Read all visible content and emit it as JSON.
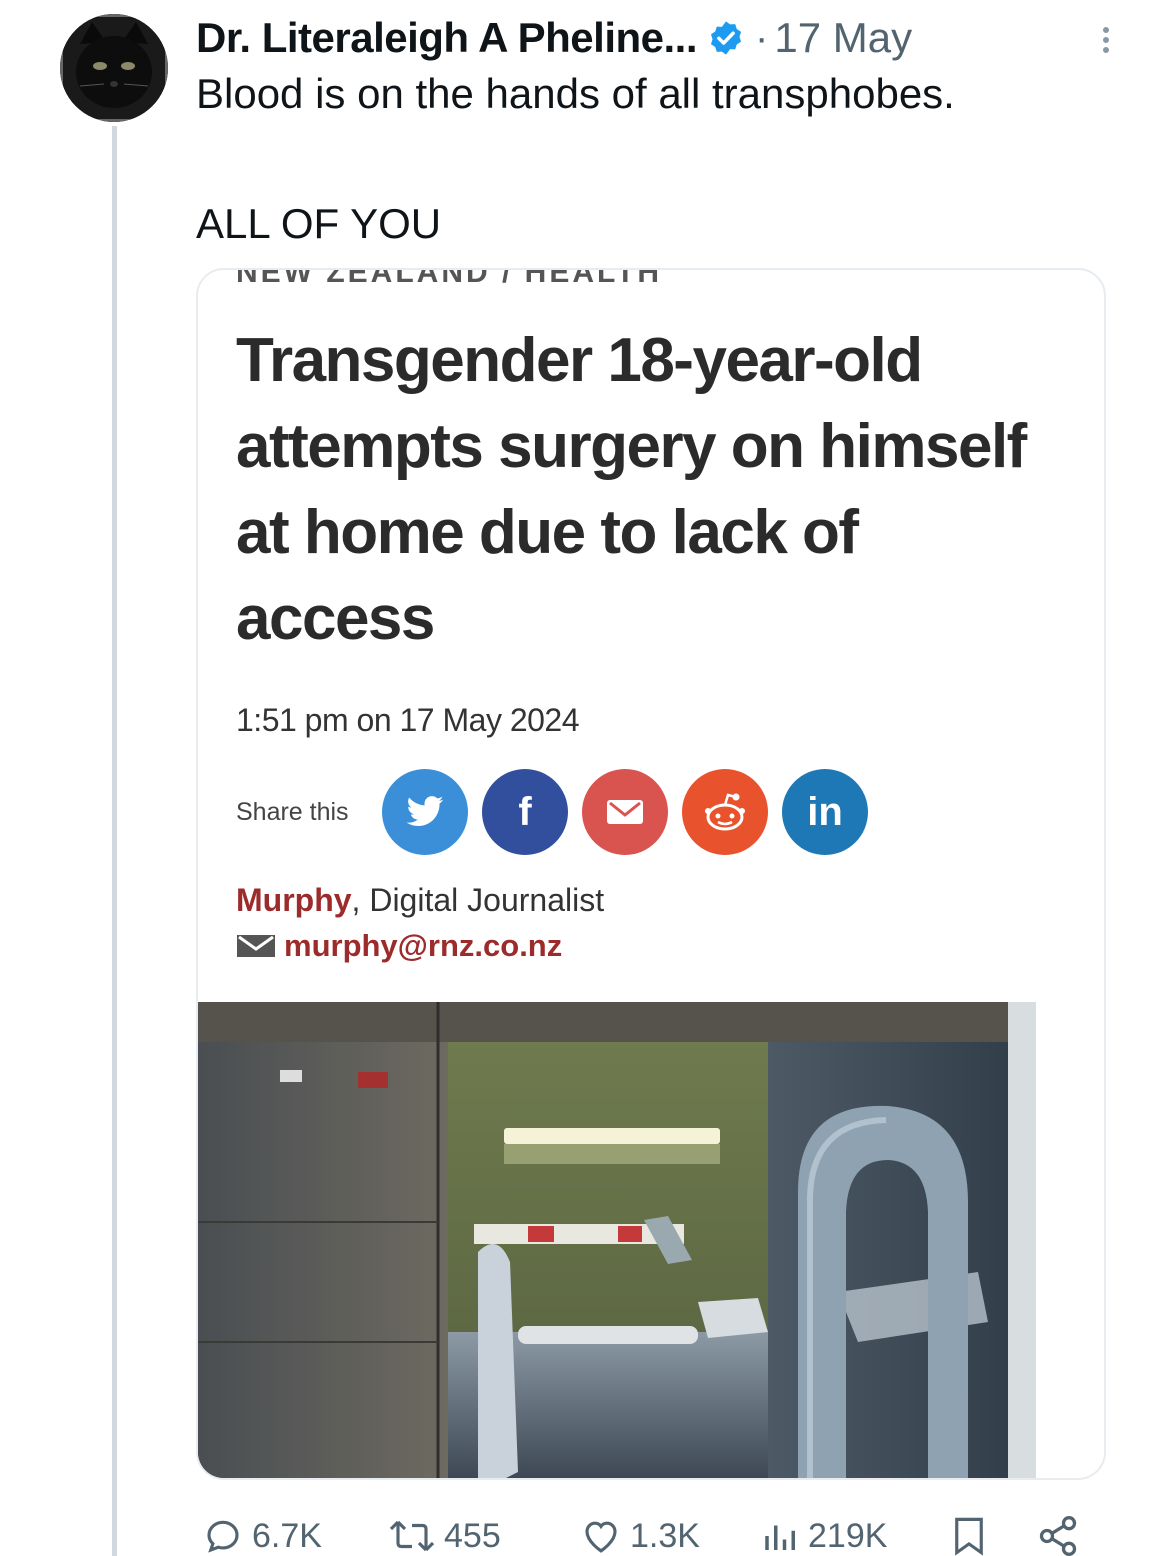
{
  "post": {
    "display_name": "Dr. Literaleigh A Pheline...",
    "date": "17 May",
    "separator": "·",
    "text_line1": "Blood is on the hands of all transphobes.",
    "text_line2": "ALL OF YOU",
    "avatar_icon": "black-cat-avatar",
    "verified_icon": "verified-badge-icon",
    "accent_color": "#1d9bf0"
  },
  "article": {
    "cut_label": "NEW ZEALAND / HEALTH",
    "headline": "Transgender 18-year-old attempts surgery on himself at home due to lack of access",
    "timestamp": "1:51 pm on 17 May 2024",
    "share_label": "Share this",
    "share_buttons": [
      {
        "name": "twitter",
        "color": "#3a8fd8"
      },
      {
        "name": "facebook",
        "color": "#324f9e",
        "glyph": "f"
      },
      {
        "name": "email",
        "color": "#d9534f"
      },
      {
        "name": "reddit",
        "color": "#e8532d"
      },
      {
        "name": "linkedin",
        "color": "#1e78b6",
        "glyph": "in"
      }
    ],
    "author": "Murphy",
    "author_role": ", Digital Journalist",
    "author_email": "murphy@rnz.co.nz",
    "image_subject": "hospital-bed-photo"
  },
  "actions": {
    "replies": "6.7K",
    "reposts": "455",
    "likes": "1.3K",
    "views": "219K"
  }
}
